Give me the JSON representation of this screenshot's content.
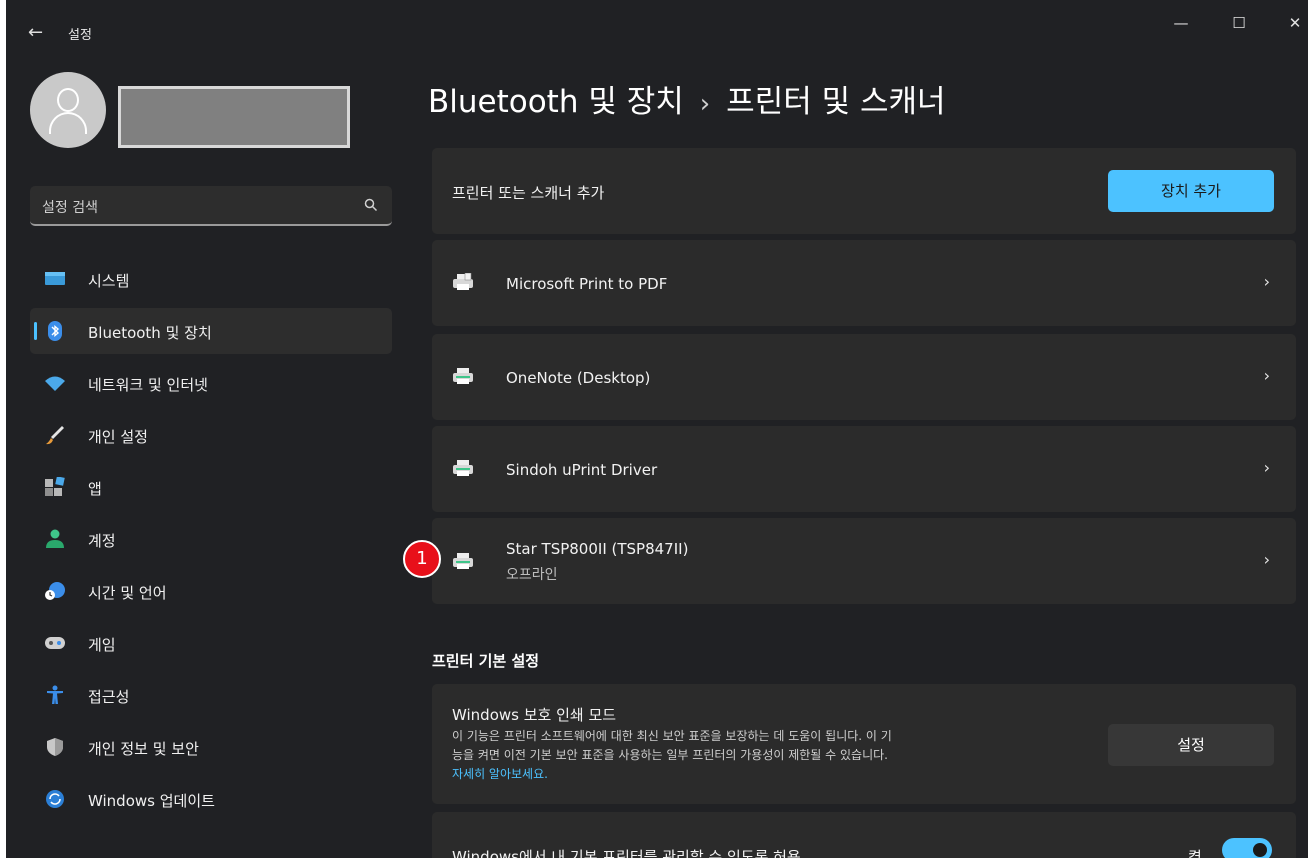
{
  "window": {
    "title": "설정",
    "back_icon": "←",
    "controls": {
      "minimize": "—",
      "maximize": "☐",
      "close": "✕"
    }
  },
  "search": {
    "placeholder": "설정 검색"
  },
  "sidebar": {
    "items": [
      {
        "label": "시스템",
        "icon": "monitor-icon",
        "active": false
      },
      {
        "label": "Bluetooth 및 장치",
        "icon": "bluetooth-icon",
        "active": true
      },
      {
        "label": "네트워크 및 인터넷",
        "icon": "wifi-icon",
        "active": false
      },
      {
        "label": "개인 설정",
        "icon": "brush-icon",
        "active": false
      },
      {
        "label": "앱",
        "icon": "apps-icon",
        "active": false
      },
      {
        "label": "계정",
        "icon": "person-icon",
        "active": false
      },
      {
        "label": "시간 및 언어",
        "icon": "globe-clock-icon",
        "active": false
      },
      {
        "label": "게임",
        "icon": "controller-icon",
        "active": false
      },
      {
        "label": "접근성",
        "icon": "accessibility-icon",
        "active": false
      },
      {
        "label": "개인 정보 및 보안",
        "icon": "shield-icon",
        "active": false
      },
      {
        "label": "Windows 업데이트",
        "icon": "update-icon",
        "active": false
      }
    ]
  },
  "breadcrumb": {
    "parent": "Bluetooth 및 장치",
    "separator": "›",
    "current": "프린터 및 스캐너"
  },
  "add_printer": {
    "label": "프린터 또는 스캐너 추가",
    "button": "장치 추가"
  },
  "devices": [
    {
      "name": "Microsoft Print to PDF",
      "status": ""
    },
    {
      "name": "OneNote (Desktop)",
      "status": ""
    },
    {
      "name": "Sindoh uPrint Driver",
      "status": ""
    },
    {
      "name": "Star TSP800II (TSP847II)",
      "status": "오프라인"
    }
  ],
  "marker": {
    "number": "1"
  },
  "preferences": {
    "title": "프린터 기본 설정",
    "protected_mode": {
      "title": "Windows 보호 인쇄 모드",
      "description_line1": "이 기능은 프린터 소프트웨어에 대한 최신 보안 표준을 보장하는 데 도움이 됩니다. 이 기",
      "description_line2": "능을 켜면 이전 기본 보안 표준을 사용하는 일부 프린터의 가용성이 제한될 수 있습니다.",
      "link": "자세히 알아보세요.",
      "button": "설정"
    },
    "manage_default": {
      "label": "Windows에서 내 기본 프린터를 관리할 수 있도록 허용",
      "state": "켬"
    }
  },
  "colors": {
    "accent": "#4cc2ff",
    "background": "#202124",
    "card": "#2b2b2b",
    "marker": "#e8101a"
  }
}
